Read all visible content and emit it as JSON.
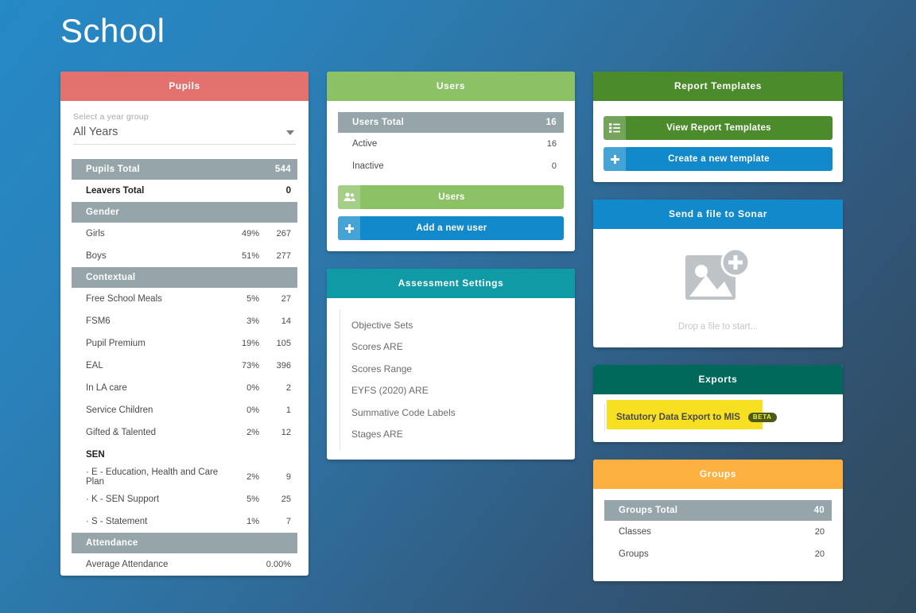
{
  "page": {
    "title": "School"
  },
  "colors": {
    "pupils_header": "#e3726f",
    "users_header": "#8cc265",
    "assessment_header": "#0f9aa5",
    "reports_header": "#4c8b2b",
    "sonar_header": "#1289ca",
    "exports_header": "#00695c",
    "groups_header": "#fbb040",
    "section_row": "#95a5a9",
    "highlight": "#f7e021"
  },
  "pupils": {
    "header": "Pupils",
    "select": {
      "label": "Select a year group",
      "value": "All Years"
    },
    "rows": [
      {
        "type": "section",
        "label": "Pupils Total",
        "pct": "",
        "val": "544"
      },
      {
        "type": "total",
        "label": "Leavers Total",
        "pct": "",
        "val": "0"
      },
      {
        "type": "section",
        "label": "Gender",
        "pct": "",
        "val": ""
      },
      {
        "type": "item",
        "label": "Girls",
        "pct": "49%",
        "val": "267"
      },
      {
        "type": "item",
        "label": "Boys",
        "pct": "51%",
        "val": "277"
      },
      {
        "type": "section",
        "label": "Contextual",
        "pct": "",
        "val": ""
      },
      {
        "type": "item",
        "label": "Free School Meals",
        "pct": "5%",
        "val": "27"
      },
      {
        "type": "item",
        "label": "FSM6",
        "pct": "3%",
        "val": "14"
      },
      {
        "type": "item",
        "label": "Pupil Premium",
        "pct": "19%",
        "val": "105"
      },
      {
        "type": "item",
        "label": "EAL",
        "pct": "73%",
        "val": "396"
      },
      {
        "type": "item",
        "label": "In LA care",
        "pct": "0%",
        "val": "2"
      },
      {
        "type": "item",
        "label": "Service Children",
        "pct": "0%",
        "val": "1"
      },
      {
        "type": "item",
        "label": "Gifted & Talented",
        "pct": "2%",
        "val": "12"
      },
      {
        "type": "subhead",
        "label": "SEN",
        "pct": "",
        "val": ""
      },
      {
        "type": "item",
        "label": "· E - Education, Health and Care Plan",
        "pct": "2%",
        "val": "9"
      },
      {
        "type": "item",
        "label": "· K - SEN Support",
        "pct": "5%",
        "val": "25"
      },
      {
        "type": "item",
        "label": "· S - Statement",
        "pct": "1%",
        "val": "7"
      },
      {
        "type": "section",
        "label": "Attendance",
        "pct": "",
        "val": ""
      },
      {
        "type": "item",
        "label": "Average Attendance",
        "pct": "",
        "val": "0.00%"
      }
    ]
  },
  "users": {
    "header": "Users",
    "rows": [
      {
        "type": "section",
        "label": "Users Total",
        "val": "16"
      },
      {
        "type": "item",
        "label": "Active",
        "val": "16"
      },
      {
        "type": "item",
        "label": "Inactive",
        "val": "0"
      }
    ],
    "buttons": [
      {
        "label": "Users",
        "icon": "users-icon",
        "color": "#8cc265"
      },
      {
        "label": "Add a new user",
        "icon": "plus-icon",
        "color": "#1289ca"
      }
    ]
  },
  "assessment": {
    "header": "Assessment Settings",
    "items": [
      {
        "label": "Objective Sets"
      },
      {
        "label": "Scores ARE"
      },
      {
        "label": "Scores Range"
      },
      {
        "label": "EYFS (2020) ARE"
      },
      {
        "label": "Summative Code Labels"
      },
      {
        "label": "Stages ARE"
      }
    ]
  },
  "reports": {
    "header": "Report Templates",
    "buttons": [
      {
        "label": "View Report Templates",
        "icon": "list-icon",
        "color": "#4c8b2b"
      },
      {
        "label": "Create a new template",
        "icon": "plus-icon",
        "color": "#1289ca"
      }
    ]
  },
  "sonar": {
    "header": "Send a file to Sonar",
    "drop_text": "Drop a file to start..."
  },
  "exports": {
    "header": "Exports",
    "items": [
      {
        "label": "Statutory Data Export to MIS",
        "badge": "BETA"
      }
    ]
  },
  "groups": {
    "header": "Groups",
    "rows": [
      {
        "type": "section",
        "label": "Groups Total",
        "val": "40"
      },
      {
        "type": "item",
        "label": "Classes",
        "val": "20"
      },
      {
        "type": "item",
        "label": "Groups",
        "val": "20"
      }
    ]
  }
}
